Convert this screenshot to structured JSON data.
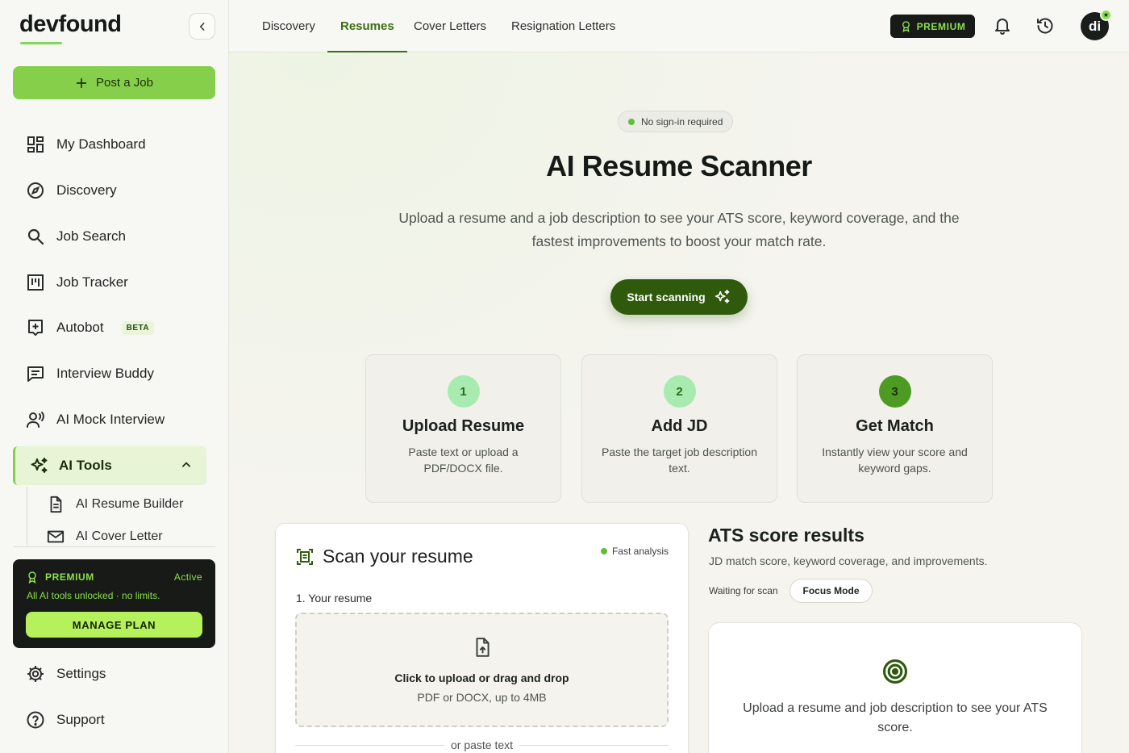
{
  "app": {
    "logo": "devfound"
  },
  "sidebar": {
    "post_job": "Post a Job",
    "items": [
      {
        "label": "My Dashboard",
        "icon": "dashboard-icon"
      },
      {
        "label": "Discovery",
        "icon": "compass-icon"
      },
      {
        "label": "Job Search",
        "icon": "search-icon"
      },
      {
        "label": "Job Tracker",
        "icon": "kanban-icon"
      },
      {
        "label": "Autobot",
        "icon": "autobot-icon",
        "badge": "BETA"
      },
      {
        "label": "Interview Buddy",
        "icon": "chat-icon"
      },
      {
        "label": "AI Mock Interview",
        "icon": "speaker-person-icon"
      }
    ],
    "ai_tools": {
      "label": "AI Tools",
      "children": [
        {
          "label": "AI Resume Builder",
          "icon": "document-icon"
        },
        {
          "label": "AI Cover Letter",
          "icon": "mail-icon"
        }
      ]
    },
    "premium": {
      "title": "PREMIUM",
      "status": "Active",
      "description": "All AI tools unlocked · no limits.",
      "manage": "MANAGE PLAN"
    },
    "bottom": [
      {
        "label": "Settings",
        "icon": "gear-icon"
      },
      {
        "label": "Support",
        "icon": "help-icon"
      }
    ]
  },
  "topnav": {
    "tabs": [
      {
        "label": "Discovery",
        "active": false
      },
      {
        "label": "Resumes",
        "active": true
      },
      {
        "label": "Cover Letters",
        "active": false
      },
      {
        "label": "Resignation Letters",
        "active": false
      }
    ],
    "premium_label": "PREMIUM",
    "avatar_initials": "di"
  },
  "hero": {
    "badge": "No sign-in required",
    "title": "AI Resume Scanner",
    "subtitle": "Upload a resume and a job description to see your ATS score, keyword coverage, and the fastest improvements to boost your match rate.",
    "cta": "Start scanning"
  },
  "steps": [
    {
      "num": "1",
      "title": "Upload Resume",
      "desc": "Paste text or upload a PDF/DOCX file."
    },
    {
      "num": "2",
      "title": "Add JD",
      "desc": "Paste the target job description text."
    },
    {
      "num": "3",
      "title": "Get Match",
      "desc": "Instantly view your score and keyword gaps."
    }
  ],
  "scan": {
    "title": "Scan your resume",
    "badge": "Fast analysis",
    "section_label": "1. Your resume",
    "dropzone_main": "Click to upload or drag and drop",
    "dropzone_sub": "PDF or DOCX, up to 4MB",
    "divider": "or paste text"
  },
  "results": {
    "title": "ATS score results",
    "subtitle": "JD match score, keyword coverage, and improvements.",
    "status": "Waiting for scan",
    "focus_mode": "Focus Mode",
    "empty_text": "Upload a resume and job description to see your ATS score."
  },
  "colors": {
    "accent": "#86cf4b",
    "dark_green": "#2f5a0c",
    "premium_green": "#8be04e"
  }
}
